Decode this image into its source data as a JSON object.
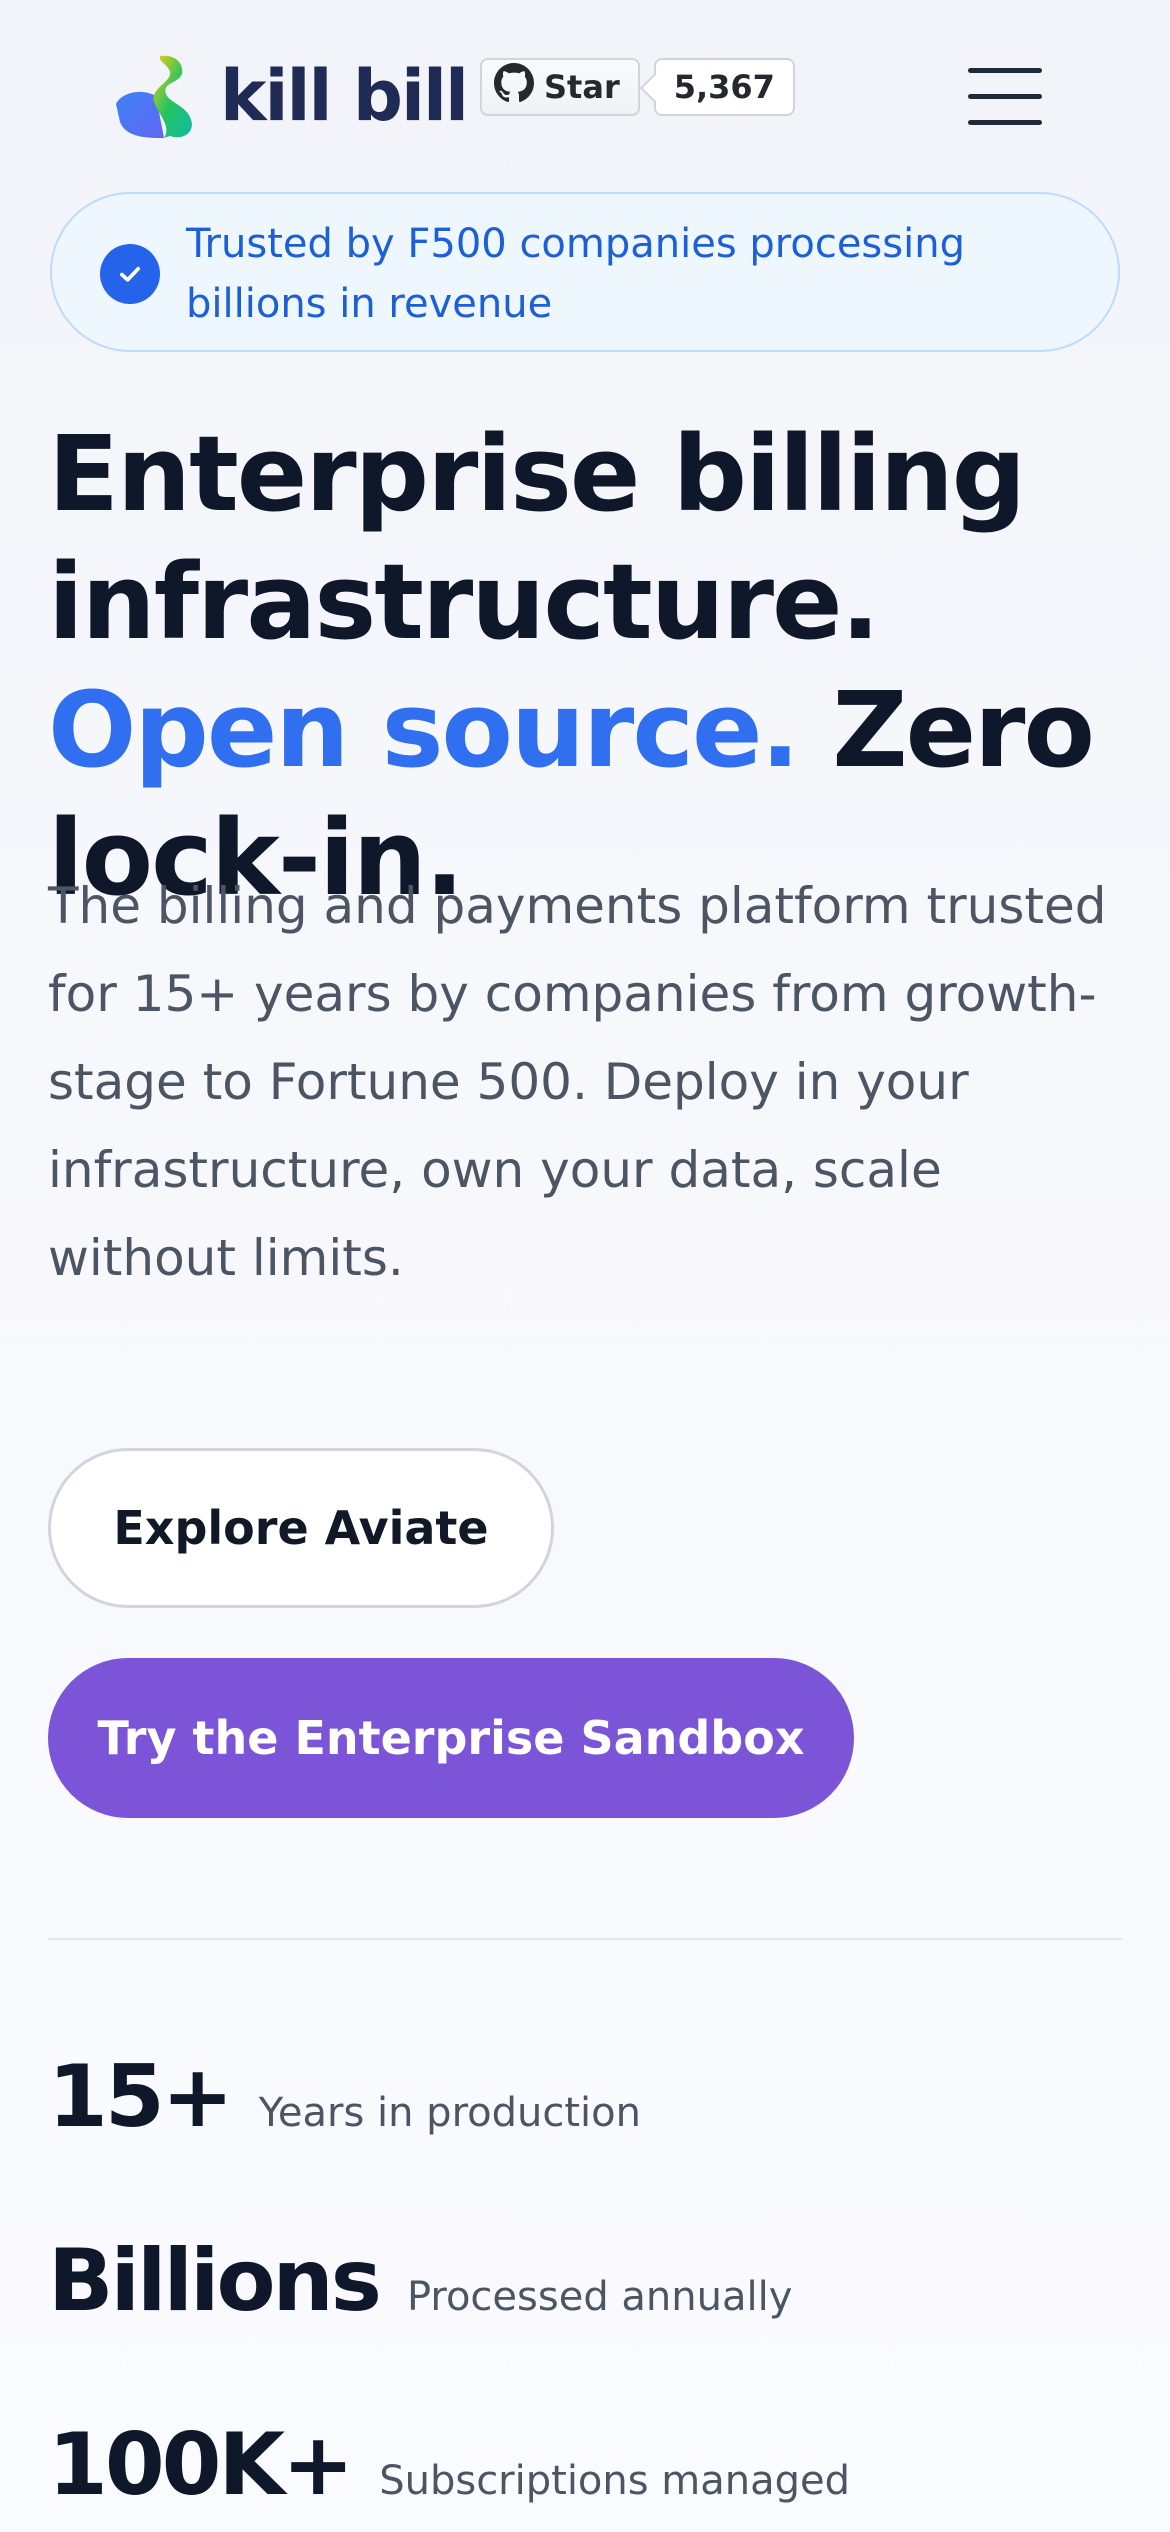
{
  "header": {
    "brand_name": "kill bill",
    "github_star_label": "Star",
    "github_star_count": "5,367"
  },
  "trust_badge": {
    "text": "Trusted by F500 companies processing billions in revenue"
  },
  "hero": {
    "headline_part1": "Enterprise billing infrastructure. ",
    "headline_accent": "Open source.",
    "headline_part2": " Zero lock-in.",
    "description": "The billing and payments platform trusted for 15+ years by companies from growth-stage to Fortune 500. Deploy in your infrastructure, own your data, scale without limits."
  },
  "buttons": {
    "explore_label": "Explore Aviate",
    "sandbox_label": "Try the Enterprise Sandbox"
  },
  "stats": [
    {
      "value": "15+",
      "label": "Years in production"
    },
    {
      "value": "Billions",
      "label": "Processed annually"
    },
    {
      "value": "100K+",
      "label": "Subscriptions managed"
    }
  ],
  "colors": {
    "accent_blue": "#2f6ff0",
    "primary_button": "#7b54d8",
    "badge_text": "#1d5fd6"
  }
}
